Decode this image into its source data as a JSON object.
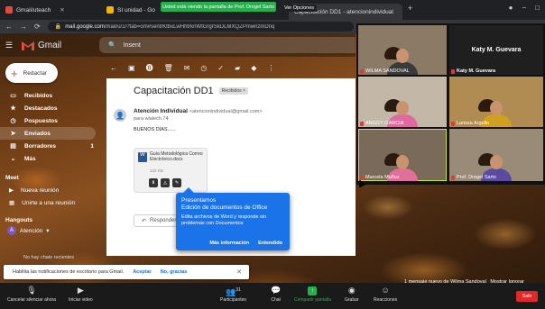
{
  "browser": {
    "tabs": [
      {
        "label": "Gmail/uteach",
        "active": false
      },
      {
        "label": "SI unidad - Go",
        "active": false
      },
      {
        "label": "Capacitación DD1 - atencionindividual",
        "active": true
      }
    ],
    "zoom_banner": "Usted está viendo la pantalla de Prof. Dregel Sarto",
    "view_options": "Ver Opciones",
    "url_host": "mail.google.com",
    "url_path": "/mail/u/1/?tab=om#sent/KtbxLwHhtrknWtGrgrSkDLMXQZPmwnzmDnq"
  },
  "gmail": {
    "app_name": "Gmail",
    "search_placeholder": "Insent",
    "compose_label": "Redactar",
    "nav": [
      {
        "label": "Recibidos",
        "icon": "inbox-icon",
        "count": "",
        "active": false
      },
      {
        "label": "Destacados",
        "icon": "star-icon",
        "count": "",
        "active": false
      },
      {
        "label": "Pospuestos",
        "icon": "clock-icon",
        "count": "",
        "active": false
      },
      {
        "label": "Enviados",
        "icon": "send-icon",
        "count": "",
        "active": true
      },
      {
        "label": "Borradores",
        "icon": "draft-icon",
        "count": "1",
        "active": false
      },
      {
        "label": "Más",
        "icon": "chevron-down-icon",
        "count": "",
        "active": false
      }
    ],
    "meet_title": "Meet",
    "meet_items": [
      "Nueva reunión",
      "Unirte a una reunión"
    ],
    "hangouts_title": "Hangouts",
    "hangouts_user": "Atención",
    "no_chats": "No hay chats recientes"
  },
  "email": {
    "subject": "Capacitación DD1",
    "label_chip": "Recibidos ×",
    "sender_name": "Atención Individual",
    "sender_email": "<atencionindividual@gmail.com>",
    "to": "para wlalech.74",
    "body": "BUENOS DÍAS......",
    "attachment": {
      "name": "Guía Metodológica Correo Electrónico.docx",
      "size": "122 KB"
    },
    "reply_label": "Responder"
  },
  "popup": {
    "title": "Presentamos\nEdición de documentos de Office",
    "description": "Edita archivos de Word y responde sin problemas con Documentos",
    "more_info": "Más información",
    "ok": "Entendido"
  },
  "notification": {
    "text": "Habilita las notificaciones de escritorio para Gmail.",
    "accept": "Aceptar",
    "decline": "No, gracias"
  },
  "zoom": {
    "participants": [
      {
        "name": "WILMA SANDOVAL",
        "video": true
      },
      {
        "name": "Katy M. Guevara",
        "video": false
      },
      {
        "name": "ANGGY GARCIA",
        "video": true
      },
      {
        "name": "Larissa Argollo",
        "video": true
      },
      {
        "name": "Marcela Muñoz",
        "video": true,
        "speaking": true
      },
      {
        "name": "Prof. Dregel Sarto",
        "video": true
      }
    ],
    "toolbar": [
      {
        "label": "Cancelar silenciar ahora",
        "icon": "mic-icon"
      },
      {
        "label": "Iniciar video",
        "icon": "video-icon"
      },
      {
        "label": "Participantes",
        "icon": "participants-icon",
        "count": "31"
      },
      {
        "label": "Chat",
        "icon": "chat-icon"
      },
      {
        "label": "Compartir pantalla",
        "icon": "share-icon"
      },
      {
        "label": "Grabar",
        "icon": "record-icon"
      },
      {
        "label": "Reacciones",
        "icon": "reactions-icon"
      }
    ],
    "leave": "Salir",
    "toast": "1 mensaje nuevo de Wilma Sandoval",
    "toast_show": "Mostrar",
    "toast_ignore": "Ignorar"
  }
}
